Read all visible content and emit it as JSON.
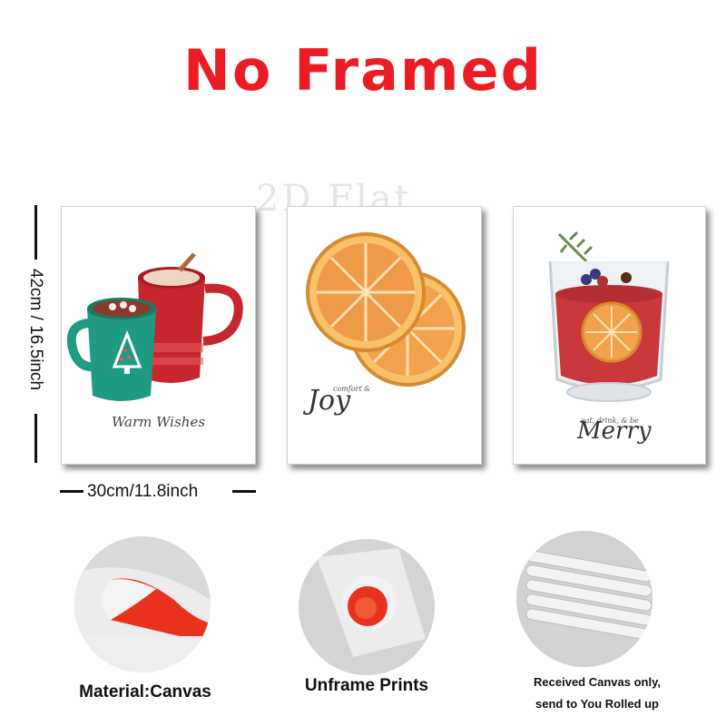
{
  "headline": "No Framed",
  "watermark": "2D Flat",
  "prints": [
    {
      "caption": "Warm Wishes"
    },
    {
      "caption_small": "comfort &",
      "caption": "Joy"
    },
    {
      "caption_small": "eat, drink, & be",
      "caption": "Merry"
    }
  ],
  "dimensions": {
    "height_label": "42cm / 16.5inch",
    "width_label": "30cm/11.8inch"
  },
  "features": [
    {
      "label": "Material:Canvas"
    },
    {
      "label": "Unframe  Prints"
    },
    {
      "label_line1": "Received Canvas only,",
      "label_line2": "send to You Rolled up"
    }
  ],
  "colors": {
    "headline": "#ec1c24",
    "canvas_back": "#e8321e",
    "mug_green": "#1f9a83",
    "mug_red": "#c8262e",
    "orange": "#f2a24a",
    "sangria": "#c9383b"
  }
}
